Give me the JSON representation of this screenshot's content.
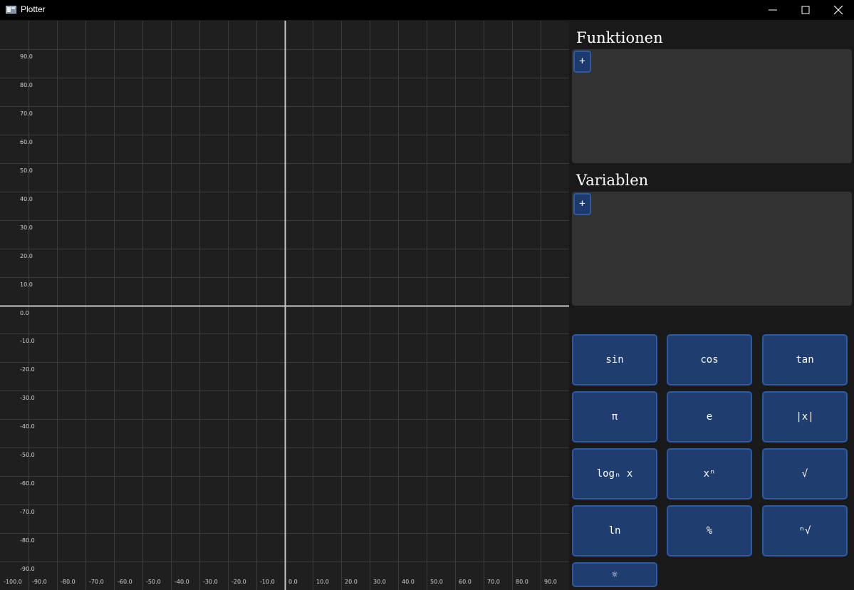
{
  "window": {
    "title": "Plotter",
    "controls": [
      "minimize-icon",
      "maximize-icon",
      "close-icon"
    ]
  },
  "plot": {
    "x_range": [
      -100,
      100
    ],
    "y_range": [
      -100,
      100
    ],
    "grid_step": 10,
    "x_tick_labels": [
      "-100.0",
      "-90.0",
      "-80.0",
      "-70.0",
      "-60.0",
      "-50.0",
      "-40.0",
      "-30.0",
      "-20.0",
      "-10.0",
      "0.0",
      "10.0",
      "20.0",
      "30.0",
      "40.0",
      "50.0",
      "60.0",
      "70.0",
      "80.0",
      "90.0"
    ],
    "y_tick_labels": [
      "90.0",
      "80.0",
      "70.0",
      "60.0",
      "50.0",
      "40.0",
      "30.0",
      "20.0",
      "10.0",
      "0.0",
      "-10.0",
      "-20.0",
      "-30.0",
      "-40.0",
      "-50.0",
      "-60.0",
      "-70.0",
      "-80.0",
      "-90.0"
    ],
    "colors": {
      "background": "#1f1f1f",
      "grid": "#3c3c3c",
      "axis": "#c8c8c8",
      "ticks": "#d2d2d2"
    }
  },
  "functions": {
    "title": "Funktionen",
    "add_label": "+"
  },
  "variables": {
    "title": "Variablen",
    "add_label": "+"
  },
  "keypad": {
    "rows": [
      [
        "sin",
        "cos",
        "tan"
      ],
      [
        "π",
        "e",
        "|x|"
      ],
      [
        "logₙ x",
        "xⁿ",
        "√"
      ],
      [
        "ln",
        "%",
        "ⁿ√"
      ]
    ],
    "theme_toggle": "☼"
  },
  "colors": {
    "accent": "#203d70",
    "accent_border": "#2d5aa4",
    "panel": "#333333",
    "sidebar": "#191919"
  }
}
